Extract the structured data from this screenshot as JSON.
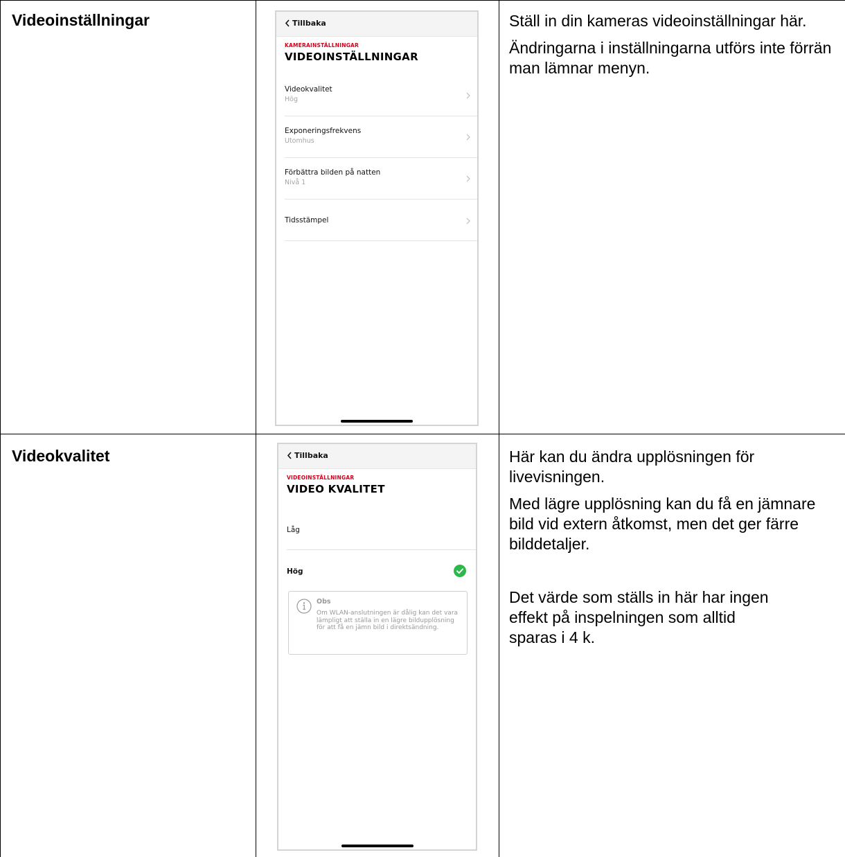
{
  "rows": [
    {
      "title": "Videoinställningar",
      "description": [
        "Ställ in din kameras videoinställningar här.",
        "Ändringarna i inställningarna utförs inte förrän man lämnar menyn."
      ],
      "phone": {
        "back_label": "Tillbaka",
        "breadcrumb": "KAMERAINSTÄLLNINGAR",
        "title": "VIDEOINSTÄLLNINGAR",
        "items": [
          {
            "label": "Videokvalitet",
            "value": "Hög"
          },
          {
            "label": "Exponeringsfrekvens",
            "value": "Utomhus"
          },
          {
            "label": "Förbättra bilden på natten",
            "value": "Nivå 1"
          },
          {
            "label": "Tidsstämpel",
            "value": ""
          }
        ]
      }
    },
    {
      "title": "Videokvalitet",
      "description": [
        "Här kan du ändra upplösningen för livevisningen.",
        "Med lägre upplösning kan du få en jämnare bild vid extern åtkomst, men det ger färre bilddetaljer.",
        "Det värde som ställs in här har ingen effekt på inspelningen som alltid sparas i 4 k."
      ],
      "phone": {
        "back_label": "Tillbaka",
        "breadcrumb": "VIDEOINSTÄLLNINGAR",
        "title": "VIDEO KVALITET",
        "options": [
          {
            "label": "Låg",
            "selected": false
          },
          {
            "label": "Hög",
            "selected": true
          }
        ],
        "notice": {
          "title": "Obs",
          "body": "Om WLAN-anslutningen är dålig kan det vara lämpligt att ställa in en lägre bildupplösning för att få en jämn bild i direktsändning."
        }
      }
    }
  ],
  "colors": {
    "accent_red": "#d6001c",
    "check_green": "#2eb84b",
    "muted_gray": "#a5a5a5"
  },
  "icons": [
    "chevron-left-icon",
    "chevron-right-icon",
    "check-circle-icon",
    "info-icon"
  ]
}
